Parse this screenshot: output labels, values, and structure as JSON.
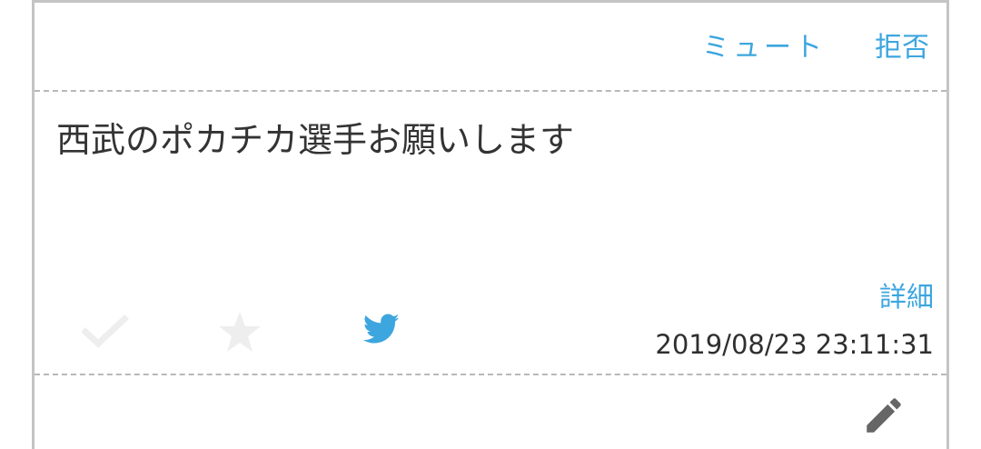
{
  "actions": {
    "mute_label": "ミュート",
    "reject_label": "拒否",
    "detail_label": "詳細"
  },
  "post": {
    "message": "西武のポカチカ選手お願いします",
    "timestamp": "2019/08/23 23:11:31"
  },
  "icons": {
    "check": "check-icon",
    "star": "star-icon",
    "share": "twitter-icon",
    "edit": "pencil-icon"
  },
  "colors": {
    "accent": "#3da6df",
    "inactive_icon": "#eeeeee",
    "edit_icon": "#666666",
    "text": "#333333"
  }
}
